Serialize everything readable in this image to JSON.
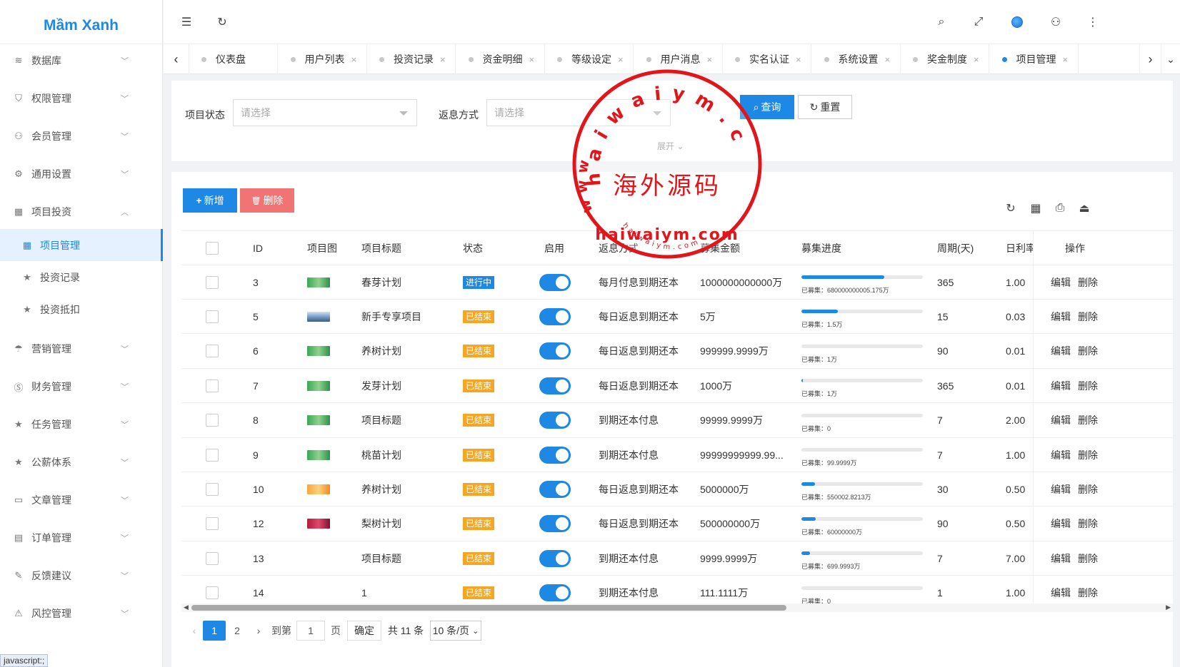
{
  "app": {
    "logo": "Mầm Xanh"
  },
  "sidebar": {
    "items": [
      {
        "label": "数据库",
        "icon": "layers-icon",
        "expanded": false
      },
      {
        "label": "权限管理",
        "icon": "shield-icon",
        "expanded": false
      },
      {
        "label": "会员管理",
        "icon": "user-icon",
        "expanded": false
      },
      {
        "label": "通用设置",
        "icon": "gear-icon",
        "expanded": false
      },
      {
        "label": "项目投资",
        "icon": "grid-icon",
        "expanded": true
      },
      {
        "label": "项目管理",
        "icon": "grid-icon",
        "sub": true,
        "active": true
      },
      {
        "label": "投资记录",
        "icon": "star-icon",
        "sub": true
      },
      {
        "label": "投资抵扣",
        "icon": "star-icon",
        "sub": true
      },
      {
        "label": "营销管理",
        "icon": "umbrella-icon",
        "expanded": false
      },
      {
        "label": "财务管理",
        "icon": "dollar-icon",
        "expanded": false
      },
      {
        "label": "任务管理",
        "icon": "star-icon",
        "expanded": false
      },
      {
        "label": "公薪体系",
        "icon": "star-icon",
        "expanded": false
      },
      {
        "label": "文章管理",
        "icon": "book-icon",
        "expanded": false
      },
      {
        "label": "订单管理",
        "icon": "calendar-icon",
        "expanded": false
      },
      {
        "label": "反馈建议",
        "icon": "note-icon",
        "expanded": false
      },
      {
        "label": "风控管理",
        "icon": "alert-icon",
        "expanded": false
      }
    ],
    "status_text": "javascript:;"
  },
  "tabs": [
    {
      "label": "仪表盘",
      "closable": false
    },
    {
      "label": "用户列表",
      "closable": true
    },
    {
      "label": "投资记录",
      "closable": true
    },
    {
      "label": "资金明细",
      "closable": true
    },
    {
      "label": "等级设定",
      "closable": true
    },
    {
      "label": "用户消息",
      "closable": true
    },
    {
      "label": "实名认证",
      "closable": true
    },
    {
      "label": "系统设置",
      "closable": true
    },
    {
      "label": "奖金制度",
      "closable": true
    },
    {
      "label": "项目管理",
      "closable": true,
      "active": true
    }
  ],
  "search": {
    "status_label": "项目状态",
    "status_placeholder": "请选择",
    "method_label": "返息方式",
    "method_placeholder": "请选择",
    "query_label": "查询",
    "reset_label": "重置",
    "expand_label": "展开"
  },
  "toolbar": {
    "add_label": "新增",
    "delete_label": "删除"
  },
  "table": {
    "headers": {
      "id": "ID",
      "image": "项目图",
      "title": "项目标题",
      "status": "状态",
      "enabled": "启用",
      "method": "返息方式",
      "amount": "募集金额",
      "progress": "募集进度",
      "period": "周期(天)",
      "rate": "日利率",
      "ops": "操作"
    },
    "progress_prefix": "已募集：",
    "edit_label": "编辑",
    "delete_label": "删除",
    "rows": [
      {
        "id": "3",
        "thumb": "green",
        "title": "春芽计划",
        "status": "进行中",
        "status_color": "blue",
        "method": "每月付息到期还本",
        "amount": "1000000000000万",
        "progress_pct": 68,
        "raised": "680000000005.175万",
        "period": "365",
        "rate": "1.00"
      },
      {
        "id": "5",
        "thumb": "solar",
        "title": "新手专享项目",
        "status": "已结束",
        "status_color": "orange",
        "method": "每日返息到期还本",
        "amount": "5万",
        "progress_pct": 30,
        "raised": "1.5万",
        "period": "15",
        "rate": "0.03"
      },
      {
        "id": "6",
        "thumb": "green",
        "title": "养树计划",
        "status": "已结束",
        "status_color": "orange",
        "method": "每日返息到期还本",
        "amount": "999999.9999万",
        "progress_pct": 0,
        "raised": "1万",
        "period": "90",
        "rate": "0.01"
      },
      {
        "id": "7",
        "thumb": "green",
        "title": "发芽计划",
        "status": "已结束",
        "status_color": "orange",
        "method": "每日返息到期还本",
        "amount": "1000万",
        "progress_pct": 1,
        "raised": "1万",
        "period": "365",
        "rate": "0.01"
      },
      {
        "id": "8",
        "thumb": "green",
        "title": "项目标题",
        "status": "已结束",
        "status_color": "orange",
        "method": "到期还本付息",
        "amount": "99999.9999万",
        "progress_pct": 0,
        "raised": "0",
        "period": "7",
        "rate": "2.00"
      },
      {
        "id": "9",
        "thumb": "green",
        "title": "桃苗计划",
        "status": "已结束",
        "status_color": "orange",
        "method": "到期还本付息",
        "amount": "99999999999.99...",
        "progress_pct": 0,
        "raised": "99.9999万",
        "period": "7",
        "rate": "1.00"
      },
      {
        "id": "10",
        "thumb": "orange",
        "title": "养树计划",
        "status": "已结束",
        "status_color": "orange",
        "method": "每日返息到期还本",
        "amount": "5000000万",
        "progress_pct": 11,
        "raised": "550002.8213万",
        "period": "30",
        "rate": "0.50"
      },
      {
        "id": "12",
        "thumb": "red",
        "title": "梨树计划",
        "status": "已结束",
        "status_color": "orange",
        "method": "每日返息到期还本",
        "amount": "500000000万",
        "progress_pct": 12,
        "raised": "60000000万",
        "period": "90",
        "rate": "0.50"
      },
      {
        "id": "13",
        "thumb": "none",
        "title": "项目标题",
        "status": "已结束",
        "status_color": "orange",
        "method": "到期还本付息",
        "amount": "9999.9999万",
        "progress_pct": 7,
        "raised": "699.9993万",
        "period": "7",
        "rate": "7.00"
      },
      {
        "id": "14",
        "thumb": "none",
        "title": "1",
        "status": "已结束",
        "status_color": "orange",
        "method": "到期还本付息",
        "amount": "111.1111万",
        "progress_pct": 0,
        "raised": "0",
        "period": "1",
        "rate": "1.00"
      }
    ]
  },
  "pagination": {
    "pages": [
      "1",
      "2"
    ],
    "current": "1",
    "goto_prefix": "到第",
    "goto_value": "1",
    "goto_suffix": "页",
    "confirm_label": "确定",
    "total_label": "共 11 条",
    "page_size": "10 条/页"
  },
  "watermark": {
    "top_arc": "haiwaiym.com",
    "left_arc": "www.",
    "center": "海外源码",
    "band": "haiwaiym.com",
    "bottom_arc": "haiwaiym.com"
  }
}
